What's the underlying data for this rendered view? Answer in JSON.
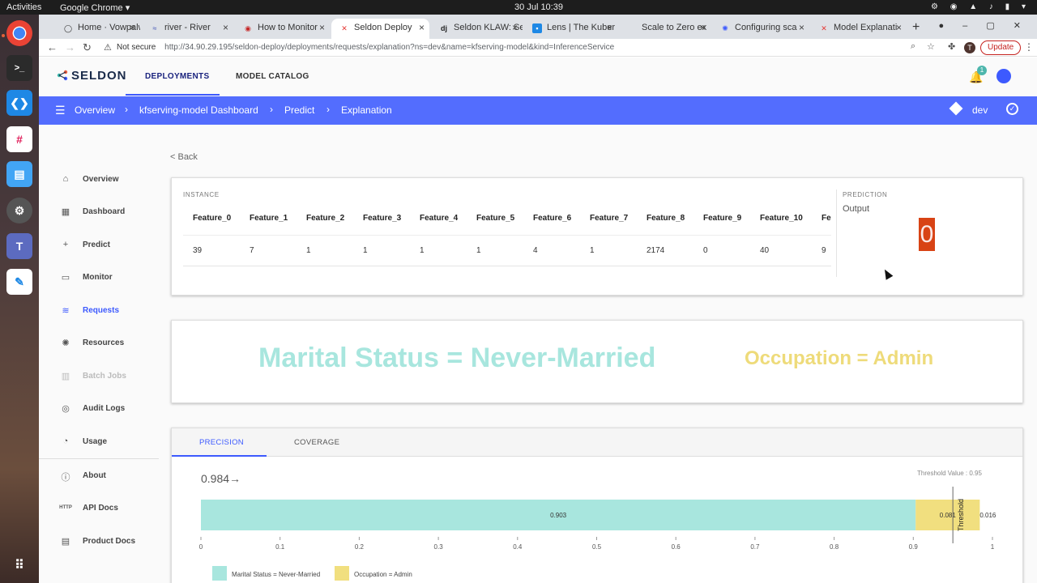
{
  "desktop": {
    "activities": "Activities",
    "app_name": "Google Chrome ▾",
    "clock": "30 Jul  10:39"
  },
  "tabs": [
    {
      "label": "Home · Vowpalw",
      "color": "#555"
    },
    {
      "label": "river - River",
      "color": "#3f51b5"
    },
    {
      "label": "How to Monitor",
      "color": "#c62828"
    },
    {
      "label": "Seldon Deploy",
      "color": "#e53935"
    },
    {
      "label": "Seldon KLAW: Se",
      "color": "#222"
    },
    {
      "label": "Lens | The Kuber",
      "color": "#1e88e5"
    },
    {
      "label": "Scale to Zero ex",
      "color": "#999"
    },
    {
      "label": "Configuring sca",
      "color": "#3d5afe"
    },
    {
      "label": "Model Explanati",
      "color": "#e53935"
    }
  ],
  "omnibox": {
    "security": "Not secure",
    "url": "http://34.90.29.195/seldon-deploy/deployments/requests/explanation?ns=dev&name=kfserving-model&kind=InferenceService",
    "profile_initial": "T",
    "update_label": "Update"
  },
  "app": {
    "logo": "SELDON",
    "nav_tabs": [
      "DEPLOYMENTS",
      "MODEL CATALOG"
    ],
    "notifications": "1"
  },
  "breadcrumbs": [
    "Overview",
    "kfserving-model Dashboard",
    "Predict",
    "Explanation"
  ],
  "environment": "dev",
  "sidebar": [
    {
      "label": "Overview",
      "icon": "home-icon"
    },
    {
      "label": "Dashboard",
      "icon": "dashboard-icon"
    },
    {
      "label": "Predict",
      "icon": "plus-icon"
    },
    {
      "label": "Monitor",
      "icon": "monitor-icon"
    },
    {
      "label": "Requests",
      "icon": "requests-icon"
    },
    {
      "label": "Resources",
      "icon": "resources-icon"
    },
    {
      "label": "Batch Jobs",
      "icon": "batch-icon"
    },
    {
      "label": "Audit Logs",
      "icon": "audit-icon"
    },
    {
      "label": "Usage",
      "icon": "usage-icon"
    },
    {
      "label": "About",
      "icon": "info-icon"
    },
    {
      "label": "API Docs",
      "icon": "http-icon"
    },
    {
      "label": "Product Docs",
      "icon": "docs-icon"
    }
  ],
  "back_label": "< Back",
  "instance": {
    "caption": "INSTANCE",
    "headers": [
      "Feature_0",
      "Feature_1",
      "Feature_2",
      "Feature_3",
      "Feature_4",
      "Feature_5",
      "Feature_6",
      "Feature_7",
      "Feature_8",
      "Feature_9",
      "Feature_10",
      "Fe"
    ],
    "values": [
      "39",
      "7",
      "1",
      "1",
      "1",
      "1",
      "4",
      "1",
      "2174",
      "0",
      "40",
      "9"
    ]
  },
  "prediction": {
    "caption": "PREDICTION",
    "output_label": "Output",
    "output_value": "0"
  },
  "anchors": [
    "Marital Status = Never-Married",
    "Occupation = Admin"
  ],
  "chart_tabs": [
    "PRECISION",
    "COVERAGE"
  ],
  "precision_value": "0.984",
  "precision_arrow": "→",
  "threshold_text": "Threshold Value : 0.95",
  "threshold_label": "Threshold",
  "chart_data": {
    "type": "bar",
    "orientation": "horizontal-stacked",
    "xlim": [
      0,
      1
    ],
    "threshold": 0.95,
    "segments": [
      {
        "name": "Marital Status = Never-Married",
        "value": 0.903,
        "label": "0.903",
        "color": "#a8e6de"
      },
      {
        "name": "Occupation = Admin",
        "value": 0.081,
        "label": "0.081",
        "color": "#f1df7f"
      }
    ],
    "total": 0.984,
    "total_label": "0.016",
    "x_ticks": [
      "0",
      "0.1",
      "0.2",
      "0.3",
      "0.4",
      "0.5",
      "0.6",
      "0.7",
      "0.8",
      "0.9",
      "1"
    ],
    "legend": [
      "Marital Status = Never-Married",
      "Occupation = Admin"
    ]
  }
}
